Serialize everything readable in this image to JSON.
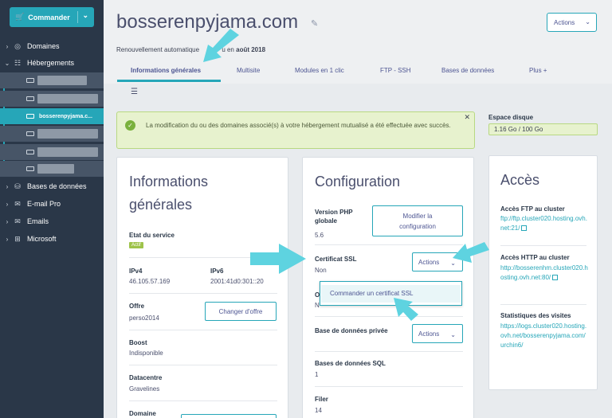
{
  "sidebar": {
    "order_button": "Commander",
    "items": [
      {
        "label": "Domaines",
        "icon": "globe-icon"
      },
      {
        "label": "Hébergements",
        "icon": "server-icon"
      },
      {
        "label": "Bases de données",
        "icon": "database-icon"
      },
      {
        "label": "E-mail Pro",
        "icon": "mail-icon"
      },
      {
        "label": "Emails",
        "icon": "mail-icon"
      },
      {
        "label": "Microsoft",
        "icon": "windows-icon"
      }
    ],
    "active_hosting": "bosserenpyjama.c..."
  },
  "header": {
    "title": "bosserenpyjama.com",
    "renewal_prefix": "Renouvellement automatique",
    "renewal_middle": "u en",
    "renewal_date": "août 2018",
    "actions": "Actions",
    "tabs": [
      "Informations générales",
      "Multisite",
      "Modules en 1 clic",
      "FTP - SSH",
      "Bases de données",
      "Plus +"
    ]
  },
  "alert": {
    "message": "La modification du ou des domaines associé(s) à votre hébergement mutualisé a été effectuée avec succès."
  },
  "disk": {
    "label": "Espace disque",
    "value": "1.16 Go / 100 Go"
  },
  "general": {
    "title": "Informations générales",
    "service_state_label": "Etat du service",
    "service_state": "Actif",
    "ipv4_label": "IPv4",
    "ipv4": "46.105.57.169",
    "ipv6_label": "IPv6",
    "ipv6": "2001:41d0:301::20",
    "offer_label": "Offre",
    "offer": "perso2014",
    "change_offer": "Changer d'offre",
    "boost_label": "Boost",
    "boost": "Indisponible",
    "datacenter_label": "Datacentre",
    "datacenter": "Gravelines",
    "domain_label": "Domaine"
  },
  "config": {
    "title": "Configuration",
    "php_label": "Version PHP globale",
    "php_value": "5.6",
    "modify": "Modifier la configuration",
    "ssl_label": "Certificat SSL",
    "ssl_value": "Non",
    "actions": "Actions",
    "ssl_menu_item": "Commander un certificat SSL",
    "hidden_label": "O",
    "hidden_value": "N",
    "private_db_label": "Base de données privée",
    "sql_db_label": "Bases de données SQL",
    "sql_db_value": "1",
    "filer_label": "Filer",
    "filer_value": "14"
  },
  "access": {
    "title": "Accès",
    "ftp_label": "Accès FTP au cluster",
    "ftp_link": "ftp://ftp.cluster020.hosting.ovh.net:21/",
    "http_label": "Accès HTTP au cluster",
    "http_link": "http://bosserenhm.cluster020.hosting.ovh.net:80/",
    "stats_label": "Statistiques des visites",
    "stats_link": "https://logs.cluster020.hosting.ovh.net/bosserenpyjama.com/urchin6/"
  },
  "colors": {
    "accent": "#26a6b8",
    "sidebar": "#2a3748",
    "success": "#e7f2ce",
    "annotation": "#5ed3e0"
  }
}
